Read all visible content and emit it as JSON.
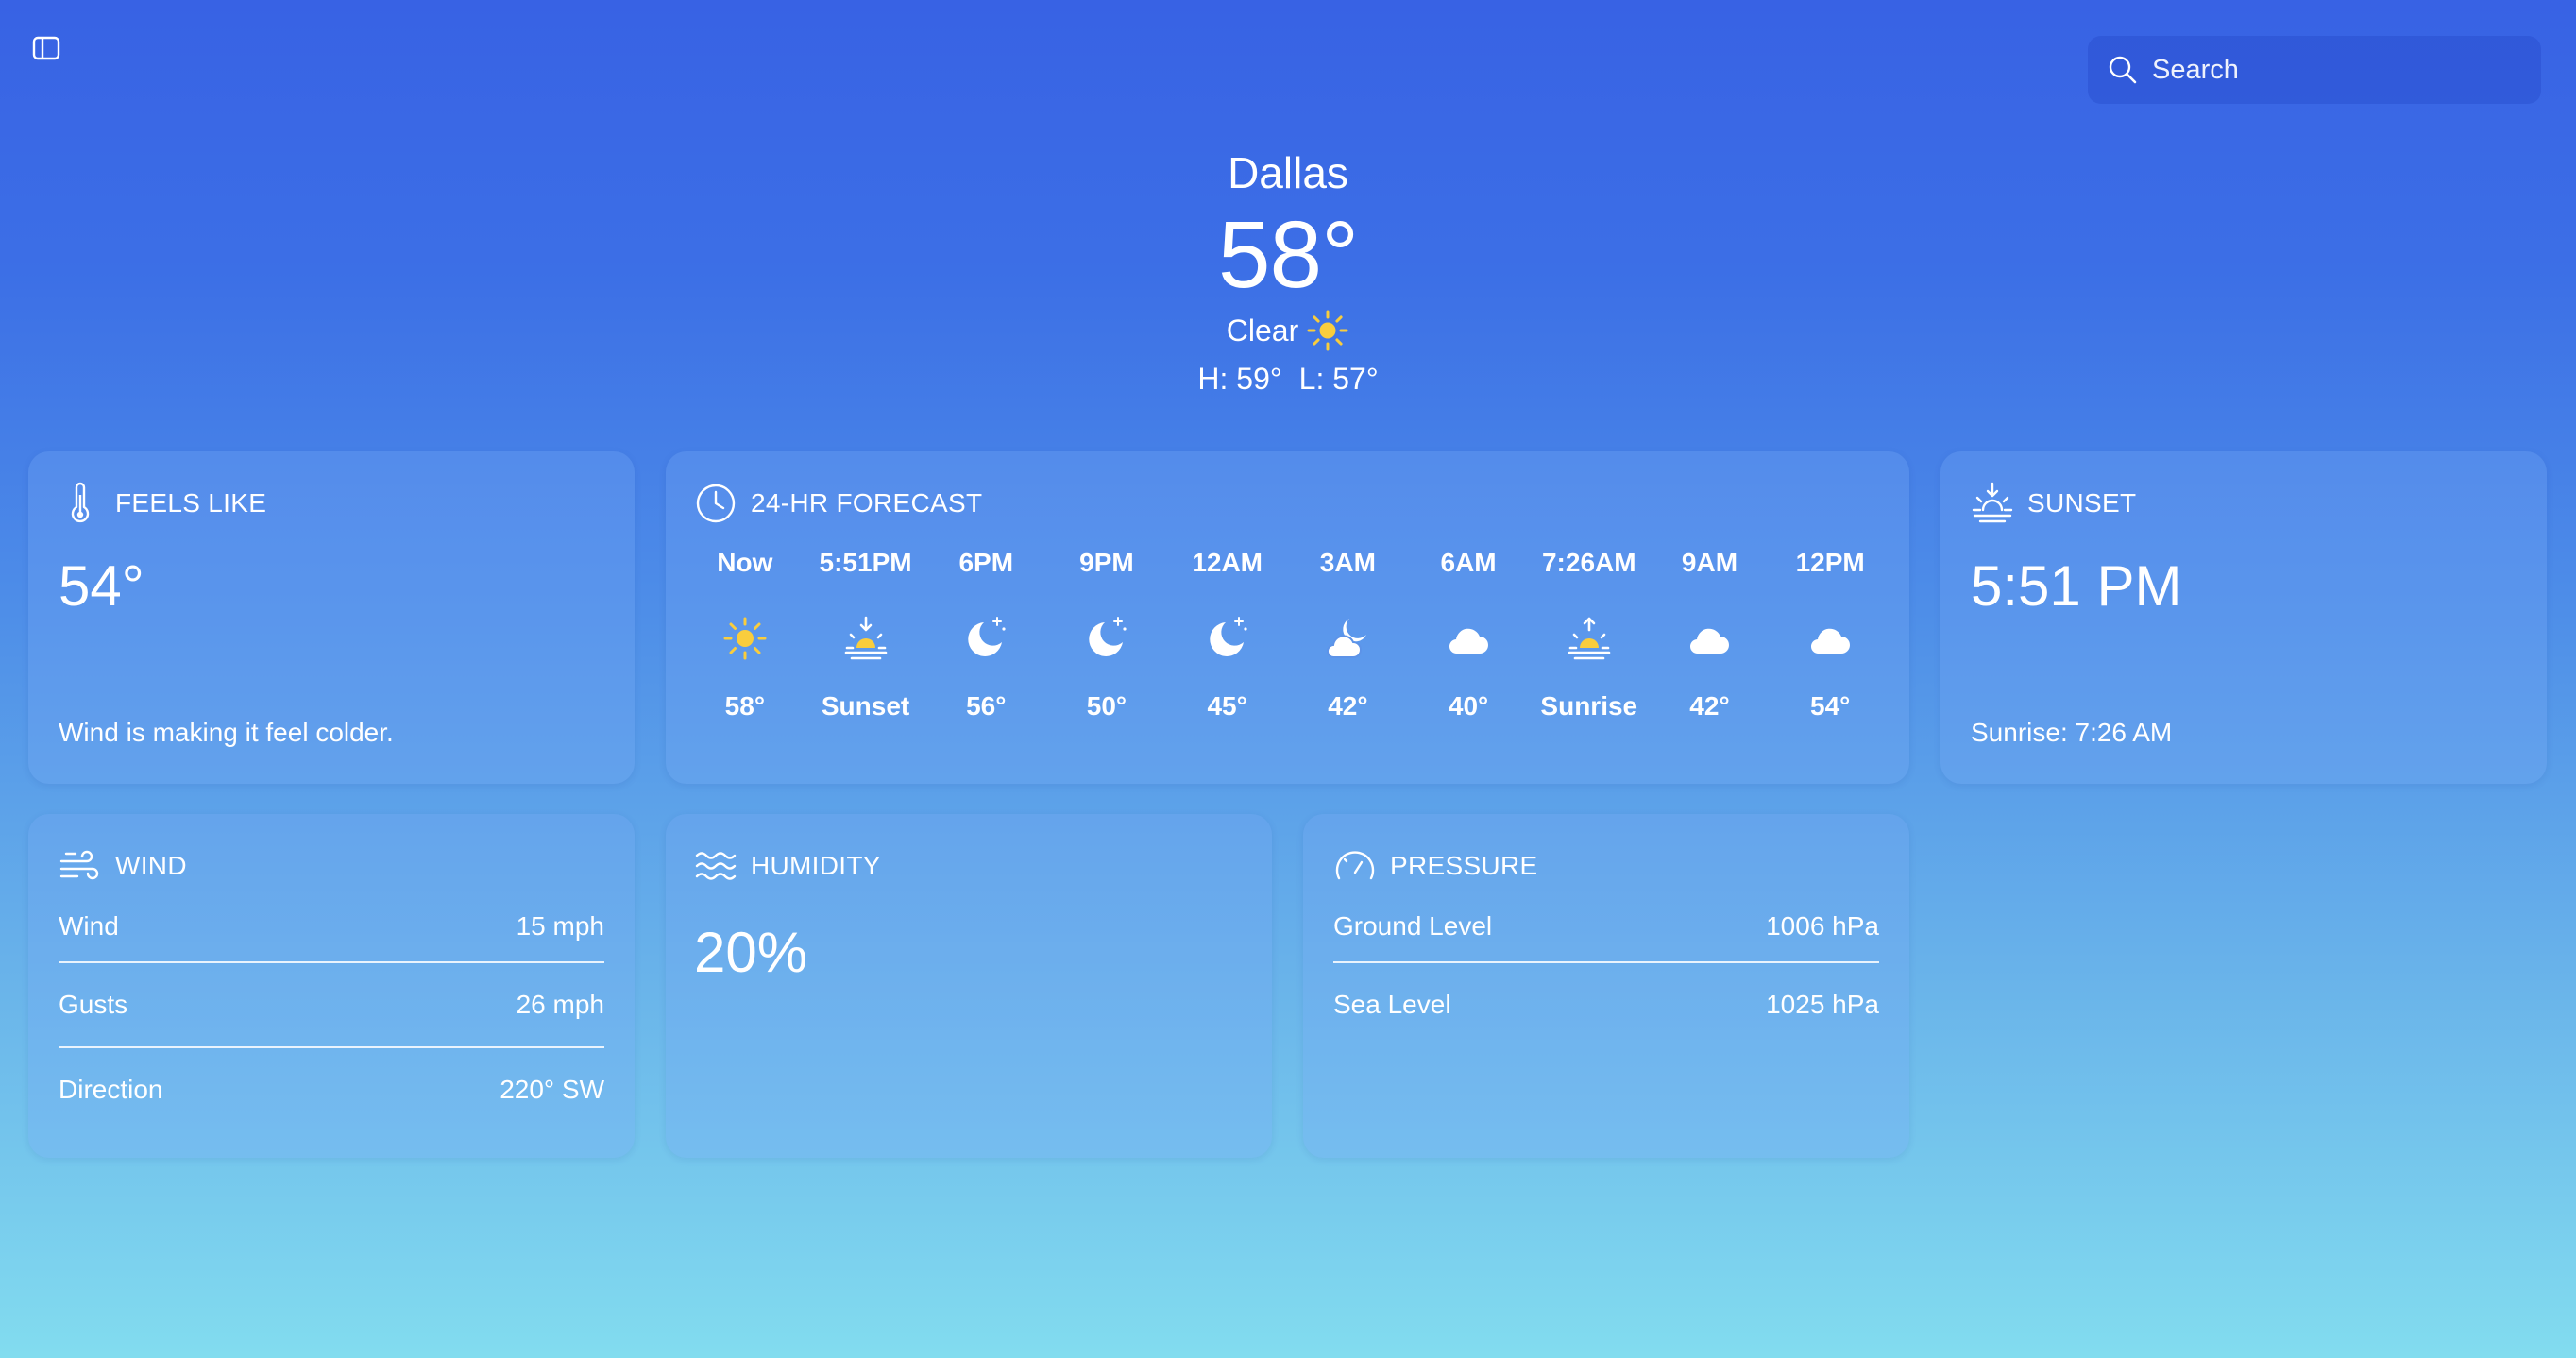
{
  "search": {
    "placeholder": "Search"
  },
  "location": {
    "city": "Dallas",
    "temperature": "58°",
    "condition": "Clear",
    "condition_icon": "sun-icon",
    "high": "H: 59°",
    "low": "L: 57°"
  },
  "feels_like": {
    "title": "FEELS LIKE",
    "icon": "thermometer-icon",
    "value": "54°",
    "description": "Wind is making it feel colder."
  },
  "forecast": {
    "title": "24-HR FORECAST",
    "icon": "clock-icon",
    "hours": [
      {
        "time": "Now",
        "icon": "sun-icon",
        "value": "58°"
      },
      {
        "time": "5:51PM",
        "icon": "sunset-icon",
        "value": "Sunset"
      },
      {
        "time": "6PM",
        "icon": "moon-stars-icon",
        "value": "56°"
      },
      {
        "time": "9PM",
        "icon": "moon-stars-icon",
        "value": "50°"
      },
      {
        "time": "12AM",
        "icon": "moon-stars-icon",
        "value": "45°"
      },
      {
        "time": "3AM",
        "icon": "cloud-moon-icon",
        "value": "42°"
      },
      {
        "time": "6AM",
        "icon": "cloud-icon",
        "value": "40°"
      },
      {
        "time": "7:26AM",
        "icon": "sunrise-icon",
        "value": "Sunrise"
      },
      {
        "time": "9AM",
        "icon": "cloud-icon",
        "value": "42°"
      },
      {
        "time": "12PM",
        "icon": "cloud-icon",
        "value": "54°"
      }
    ]
  },
  "sunset": {
    "title": "SUNSET",
    "icon": "sunset-icon",
    "value": "5:51 PM",
    "sunrise": "Sunrise: 7:26 AM"
  },
  "wind": {
    "title": "WIND",
    "icon": "wind-icon",
    "rows": [
      {
        "label": "Wind",
        "value": "15 mph"
      },
      {
        "label": "Gusts",
        "value": "26 mph"
      },
      {
        "label": "Direction",
        "value": "220° SW"
      }
    ]
  },
  "humidity": {
    "title": "HUMIDITY",
    "icon": "humidity-waves-icon",
    "value": "20%"
  },
  "pressure": {
    "title": "PRESSURE",
    "icon": "gauge-icon",
    "rows": [
      {
        "label": "Ground Level",
        "value": "1006 hPa"
      },
      {
        "label": "Sea Level",
        "value": "1025 hPa"
      }
    ]
  },
  "colors": {
    "sun_yellow": "#f9cd3d",
    "background_top": "#3862e4",
    "background_bottom": "#82dcef"
  }
}
